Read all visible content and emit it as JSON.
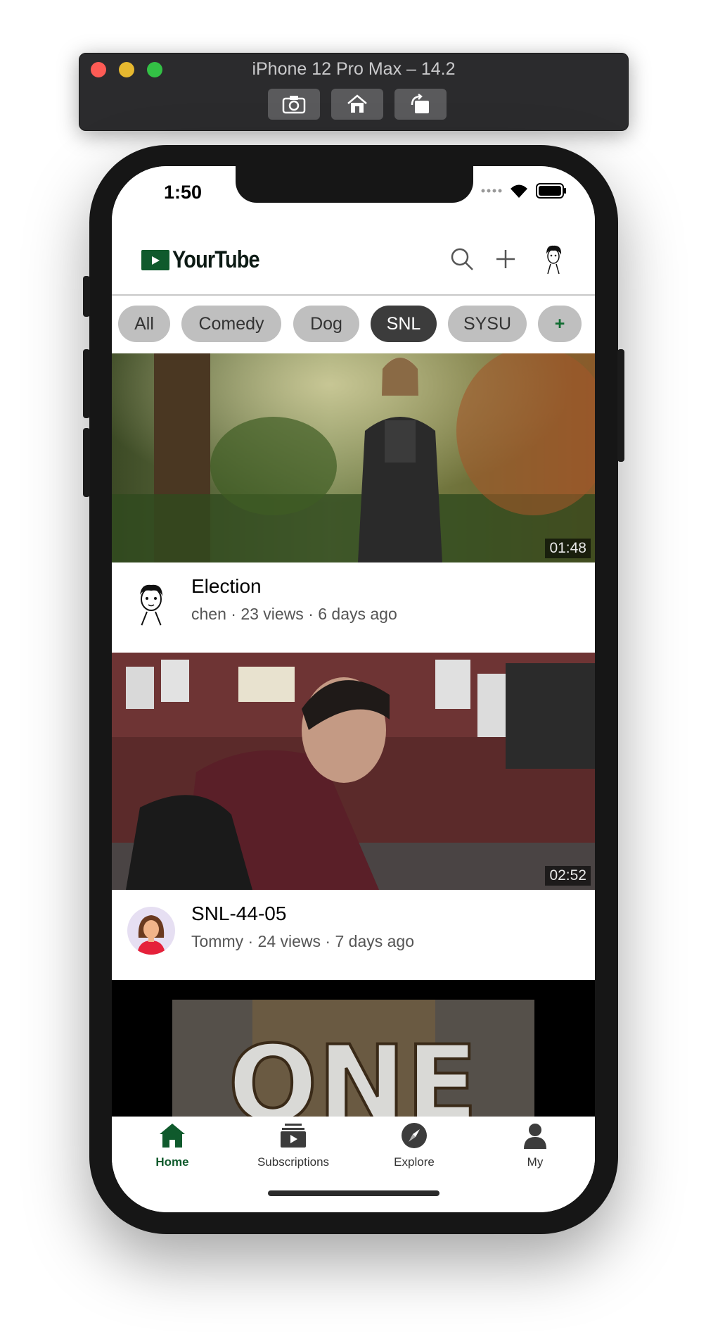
{
  "simulator": {
    "title": "iPhone 12 Pro Max – 14.2",
    "buttons": [
      "screenshot-icon",
      "home-icon",
      "rotate-icon"
    ]
  },
  "status_bar": {
    "time": "1:50"
  },
  "header": {
    "logo_text": "YourTube"
  },
  "chips": [
    {
      "label": "All",
      "active": false
    },
    {
      "label": "Comedy",
      "active": false
    },
    {
      "label": "Dog",
      "active": false
    },
    {
      "label": "SNL",
      "active": true
    },
    {
      "label": "SYSU",
      "active": false
    },
    {
      "label": "+",
      "active": false
    }
  ],
  "videos": [
    {
      "title": "Election",
      "meta": "chen · 23 views · 6 days ago",
      "duration": "01:48"
    },
    {
      "title": "SNL-44-05",
      "meta": "Tommy · 24 views · 7 days ago",
      "duration": "02:52"
    },
    {
      "overlay_text": "ONE"
    }
  ],
  "tabbar": [
    {
      "label": "Home",
      "icon": "home-icon",
      "active": true
    },
    {
      "label": "Subscriptions",
      "icon": "subscriptions-icon",
      "active": false
    },
    {
      "label": "Explore",
      "icon": "compass-icon",
      "active": false
    },
    {
      "label": "My",
      "icon": "person-icon",
      "active": false
    }
  ],
  "colors": {
    "brand": "#0f5a2c",
    "chip": "#bfbfbf",
    "chip_active": "#3c3c3c"
  }
}
